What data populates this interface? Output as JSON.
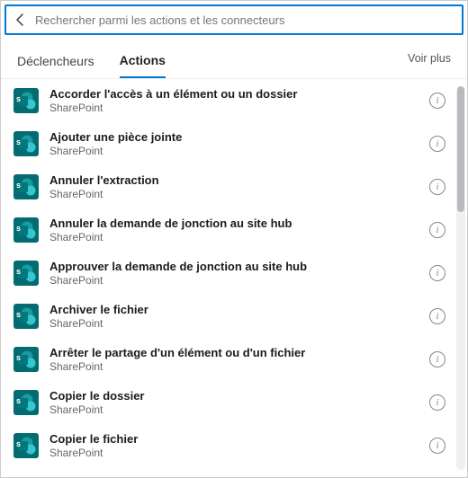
{
  "search": {
    "placeholder": "Rechercher parmi les actions et les connecteurs"
  },
  "tabs": {
    "triggers": "Déclencheurs",
    "actions": "Actions",
    "see_more": "Voir plus"
  },
  "connector_name": "SharePoint",
  "actions": [
    {
      "title": "Accorder l'accès à un élément ou un dossier"
    },
    {
      "title": "Ajouter une pièce jointe"
    },
    {
      "title": "Annuler l'extraction"
    },
    {
      "title": "Annuler la demande de jonction au site hub"
    },
    {
      "title": "Approuver la demande de jonction au site hub"
    },
    {
      "title": "Archiver le fichier"
    },
    {
      "title": "Arrêter le partage d'un élément ou d'un fichier"
    },
    {
      "title": "Copier le dossier"
    },
    {
      "title": "Copier le fichier"
    }
  ]
}
